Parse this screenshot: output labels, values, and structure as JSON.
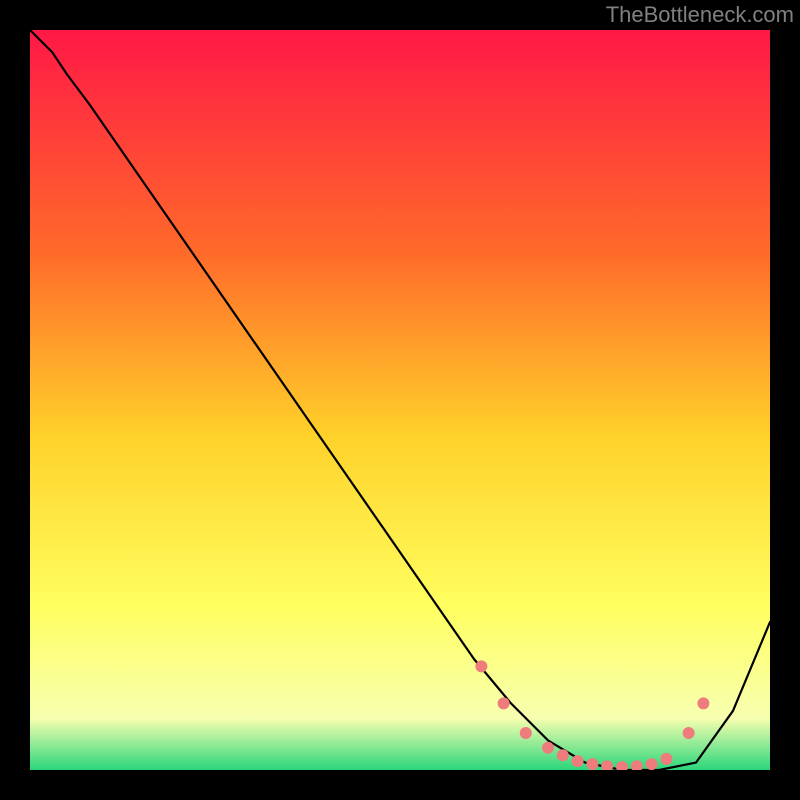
{
  "watermark": "TheBottleneck.com",
  "colors": {
    "frame_bg": "#000000",
    "curve": "#000000",
    "markers": "#ef7c7c",
    "gradient_top": "#ff1846",
    "gradient_upper_mid": "#ff6a2a",
    "gradient_mid": "#ffd22a",
    "gradient_lower_mid": "#ffff60",
    "gradient_near_bottom": "#f7ffb0",
    "gradient_bottom": "#2bd67b"
  },
  "chart_data": {
    "type": "line",
    "title": "",
    "xlabel": "",
    "ylabel": "",
    "xlim": [
      0,
      100
    ],
    "ylim": [
      0,
      100
    ],
    "grid": false,
    "legend": false,
    "series": [
      {
        "name": "bottleneck-curve",
        "x": [
          0,
          3,
          5,
          8,
          60,
          65,
          70,
          75,
          80,
          85,
          90,
          95,
          100
        ],
        "y": [
          100,
          97,
          94,
          90,
          15,
          9,
          4,
          1,
          0,
          0,
          1,
          8,
          20
        ]
      }
    ],
    "markers": {
      "name": "minimum-cluster",
      "x": [
        61,
        64,
        67,
        70,
        72,
        74,
        76,
        78,
        80,
        82,
        84,
        86,
        89,
        91
      ],
      "y": [
        14,
        9,
        5,
        3,
        2,
        1.2,
        0.8,
        0.5,
        0.4,
        0.5,
        0.8,
        1.5,
        5,
        9
      ]
    }
  }
}
